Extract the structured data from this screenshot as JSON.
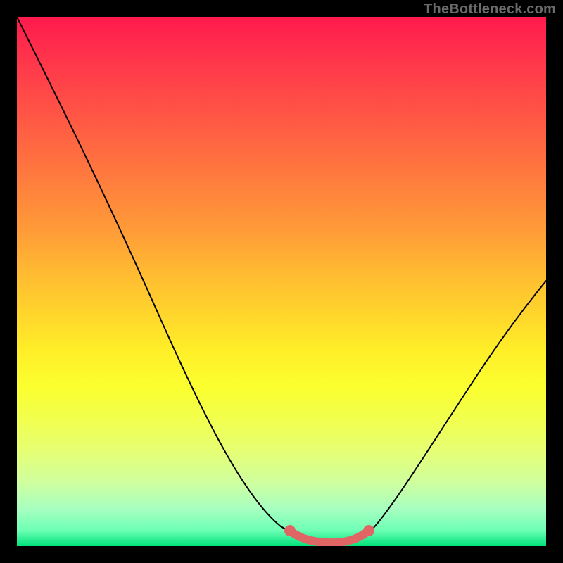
{
  "watermark": "TheBottleneck.com",
  "chart_data": {
    "type": "line",
    "title": "",
    "xlabel": "",
    "ylabel": "",
    "xlim": [
      0,
      1
    ],
    "ylim": [
      0,
      1
    ],
    "series": [
      {
        "name": "curve",
        "x": [
          0.0,
          0.05,
          0.1,
          0.15,
          0.2,
          0.25,
          0.3,
          0.35,
          0.4,
          0.45,
          0.48,
          0.51,
          0.55,
          0.6,
          0.63,
          0.66,
          0.7,
          0.75,
          0.8,
          0.85,
          0.9,
          0.95,
          1.0
        ],
        "y": [
          1.0,
          0.9,
          0.8,
          0.7,
          0.6,
          0.5,
          0.4,
          0.3,
          0.2,
          0.11,
          0.06,
          0.03,
          0.012,
          0.006,
          0.006,
          0.013,
          0.04,
          0.11,
          0.2,
          0.29,
          0.38,
          0.46,
          0.52
        ]
      }
    ],
    "valley": {
      "x": [
        0.51,
        0.55,
        0.58,
        0.61,
        0.64,
        0.66
      ],
      "y": [
        0.03,
        0.012,
        0.009,
        0.007,
        0.008,
        0.015
      ]
    },
    "gradient": [
      {
        "stop": 0.0,
        "color": "#ff1a4d"
      },
      {
        "stop": 0.5,
        "color": "#ffb932"
      },
      {
        "stop": 0.75,
        "color": "#f1ff4e"
      },
      {
        "stop": 1.0,
        "color": "#00e37a"
      }
    ]
  }
}
